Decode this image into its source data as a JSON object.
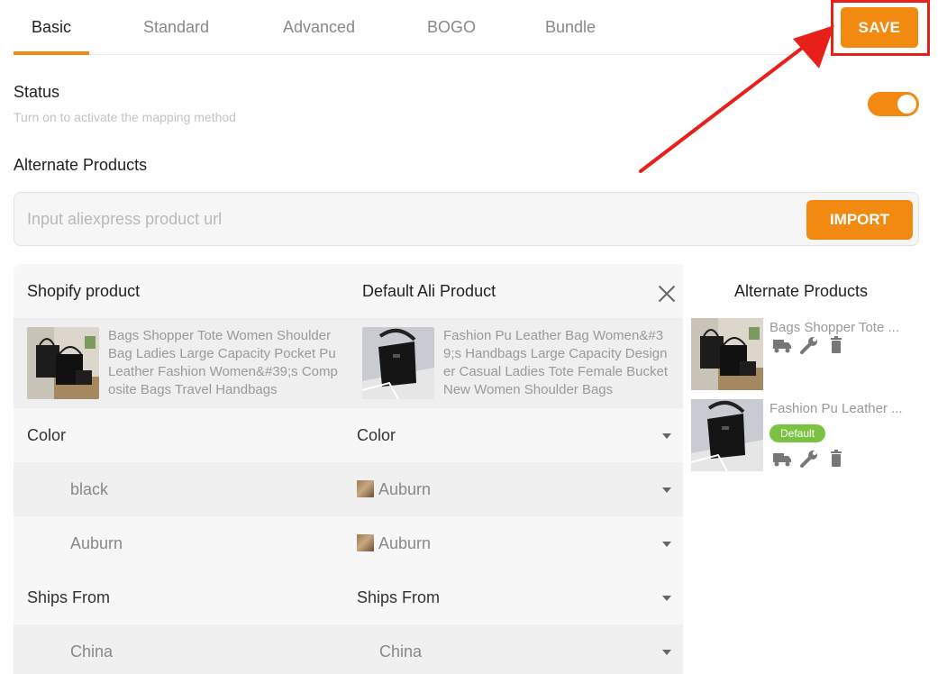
{
  "tabs": [
    {
      "label": "Basic",
      "active": true
    },
    {
      "label": "Standard",
      "active": false
    },
    {
      "label": "Advanced",
      "active": false
    },
    {
      "label": "BOGO",
      "active": false
    },
    {
      "label": "Bundle",
      "active": false
    }
  ],
  "save_label": "SAVE",
  "status": {
    "title": "Status",
    "subtitle": "Turn on to activate the mapping method",
    "enabled": true
  },
  "alternate_section_title": "Alternate Products",
  "url_input": {
    "placeholder": "Input aliexpress product url",
    "value": "",
    "import_label": "IMPORT"
  },
  "mapping": {
    "header_shopify": "Shopify product",
    "header_default": "Default Ali Product",
    "shopify_product": "Bags Shopper Tote Women Shoulder Bag Ladies Large Capacity Pocket Pu Leather Fashion Women&#39;s Composite Bags Travel Handbags",
    "default_product": "Fashion Pu Leather Bag Women&#39;s Handbags Large Capacity Designer Casual Ladies Tote Female Bucket New Women Shoulder Bags",
    "rows": [
      {
        "left": "Color",
        "right": "Color",
        "type": "option"
      },
      {
        "left": "black",
        "right": "Auburn",
        "type": "value",
        "swatch": true
      },
      {
        "left": "Auburn",
        "right": "Auburn",
        "type": "value",
        "swatch": true
      },
      {
        "left": "Ships From",
        "right": "Ships From",
        "type": "option"
      },
      {
        "left": "China",
        "right": "China",
        "type": "value",
        "swatch": false
      }
    ]
  },
  "alternate_panel": {
    "title": "Alternate Products",
    "items": [
      {
        "name": "Bags Shopper Tote ...",
        "is_default": false,
        "badge": ""
      },
      {
        "name": "Fashion Pu Leather ...",
        "is_default": true,
        "badge": "Default"
      }
    ]
  },
  "colors": {
    "accent": "#f28a12",
    "annotation_red": "#e8201a",
    "badge_green": "#7cc242"
  }
}
